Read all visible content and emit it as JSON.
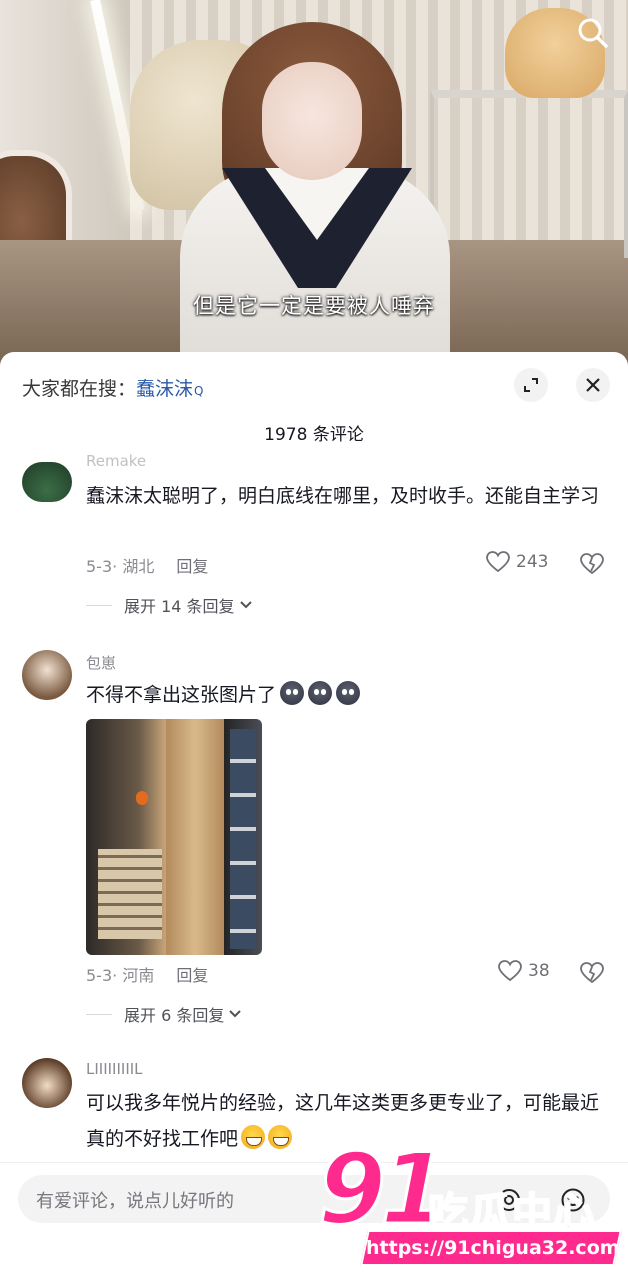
{
  "video": {
    "subtitle": "但是它一定是要被人唾弃",
    "search_icon": "search-icon"
  },
  "panel": {
    "hot_search_prefix": "大家都在搜：",
    "hot_search_term": "蠢沫沫",
    "hot_search_mark": "Q",
    "comment_count": "1978 条评论"
  },
  "comments": [
    {
      "username": "Remake",
      "text": "蠢沫沫太聪明了，明白底线在哪里，及时收手。还能自主学习",
      "date": "5-3",
      "location": "· 湖北",
      "reply_label": "回复",
      "likes": "243",
      "more_replies": "展开 14 条回复"
    },
    {
      "username": "包崽",
      "text": "不得不拿出这张图片了",
      "date": "5-3",
      "location": "· 河南",
      "reply_label": "回复",
      "likes": "38",
      "more_replies": "展开 6 条回复",
      "image": "street-storefront-photo"
    },
    {
      "username": "LIIIIIIIIIL",
      "text": "可以我多年悦片的经验，这几年这类更多更专业了，可能最近真的不好找工作吧"
    }
  ],
  "input": {
    "placeholder": "有爱评论，说点儿好听的"
  },
  "watermark": {
    "number": "91",
    "brand": "吃瓜中心",
    "url": "https://91chigua32.com"
  }
}
